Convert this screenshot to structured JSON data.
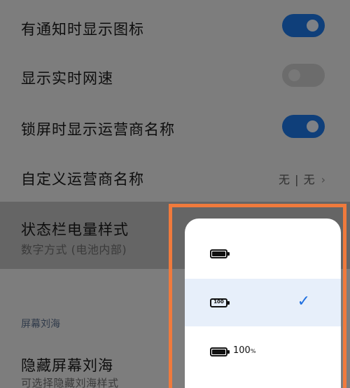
{
  "settings": {
    "notif_icons": {
      "label": "有通知时显示图标",
      "on": true
    },
    "net_speed": {
      "label": "显示实时网速",
      "on": false
    },
    "carrier_lock": {
      "label": "锁屏时显示运营商名称",
      "on": true
    },
    "custom_carrier": {
      "label": "自定义运营商名称",
      "value": "无 | 无",
      "chevron": "›"
    },
    "battery_style": {
      "label": "状态栏电量样式",
      "sub": "数字方式 (电池内部)"
    },
    "notch_section": "屏幕刘海",
    "hide_notch": {
      "label": "隐藏屏幕刘海",
      "sub": "可选择隐藏刘海样式"
    }
  },
  "battery_popup": {
    "options": [
      {
        "icon": "battery-plain-icon",
        "label": ""
      },
      {
        "icon": "battery-number-inside-icon",
        "inside_text": "100",
        "label": "",
        "selected": true
      },
      {
        "icon": "battery-number-outside-icon",
        "label": "100",
        "unit": "%"
      }
    ],
    "check": "✓"
  },
  "colors": {
    "accent": "#1f6fe0",
    "highlight_frame": "#f07a3c"
  }
}
